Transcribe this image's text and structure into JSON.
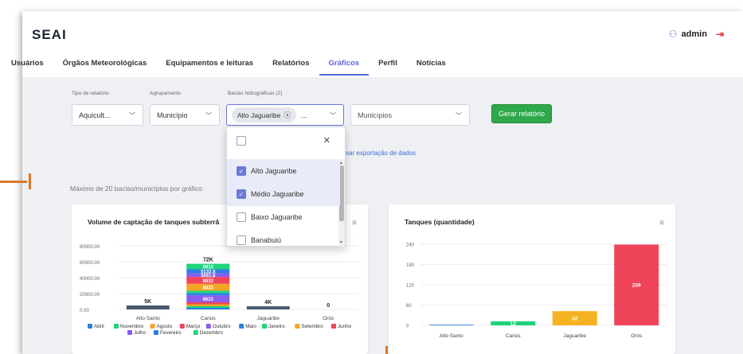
{
  "app": {
    "logo": "SEAI",
    "user": "admin"
  },
  "nav": [
    "Usuários",
    "Órgãos Meteorológicas",
    "Equipamentos e leituras",
    "Relatórios",
    "Gráficos",
    "Perfil",
    "Notícias"
  ],
  "filters": {
    "tipo_label": "Tipo de relatório",
    "tipo_value": "Aquicult...",
    "agrup_label": "Agrupamento",
    "agrup_value": "Município",
    "bacias_label": "Bacias hidrográficas (2)",
    "bacias_chip": "Alto Jaguaribe",
    "bacias_more": "...",
    "municipios_placeholder": "Municípios",
    "generate_button": "Gerar relatório",
    "export_link": "ssar exportação de dados",
    "max_note": "Máximo de 20 bacias/municípios por gráfico"
  },
  "dropdown": {
    "options": [
      {
        "label": "Alto Jaguaribe",
        "checked": true
      },
      {
        "label": "Médio Jaguaribe",
        "checked": true
      },
      {
        "label": "Baixo Jaguaribe",
        "checked": false
      },
      {
        "label": "Banabuiú",
        "checked": false
      }
    ]
  },
  "charts": {
    "left_title": "Volume de captação de tanques subterrâ",
    "right_title": "Tanques (quantidade)"
  },
  "chart_data": [
    {
      "type": "bar",
      "stacked": true,
      "title": "Volume de captação de tanques subterrâ",
      "categories": [
        "Alto Santo",
        "Canús",
        "Jaguaribe",
        "Orós"
      ],
      "yticks": [
        "80000.00",
        "60000.00",
        "40000.00",
        "20000.00",
        "0.00"
      ],
      "ylim": [
        0,
        80000
      ],
      "totals": [
        "5K",
        "72K",
        "4K",
        "0"
      ],
      "legend": [
        "Abril",
        "Novembro",
        "Agosto",
        "Março",
        "Outubro",
        "Maio",
        "Janeiro",
        "Setembro",
        "Junho",
        "Julho",
        "Fevereiro",
        "Dezembro"
      ],
      "colors": {
        "Abril": "#2b7fe0",
        "Novembro": "#1fd37a",
        "Agosto": "#f5a623",
        "Março": "#f0445a",
        "Outubro": "#8a5cf0",
        "Maio": "#2b7fe0",
        "Janeiro": "#1fd37a",
        "Setembro": "#f5a623",
        "Junho": "#f0445a",
        "Julho": "#8a5cf0",
        "Fevereiro": "#2b7fe0",
        "Dezembro": "#1fd37a"
      },
      "stacks": [
        {
          "category": "Alto Santo",
          "segments": [
            {
              "value": 5000,
              "color": "#4a5b6e"
            }
          ]
        },
        {
          "category": "Canús",
          "segments": [
            {
              "value": 2000,
              "color": "#2b7fe0"
            },
            {
              "value": 2000,
              "color": "#1fd37a"
            },
            {
              "value": 2500,
              "color": "#f5a623"
            },
            {
              "value": 2500,
              "color": "#f0445a"
            },
            {
              "value": 8632,
              "color": "#8a5cf0",
              "label": "8632"
            },
            {
              "value": 3000,
              "color": "#2b7fe0"
            },
            {
              "value": 3000,
              "color": "#1fd37a"
            },
            {
              "value": 8632,
              "color": "#f5a623",
              "label": "8832"
            },
            {
              "value": 8632,
              "color": "#f0445a",
              "label": "8832"
            },
            {
              "value": 4500,
              "color": "#8a5cf0",
              "label": "5661.6"
            },
            {
              "value": 5132.8,
              "color": "#2b7fe0",
              "label": "5132.8"
            },
            {
              "value": 6912,
              "color": "#1fd37a",
              "label": "6912"
            }
          ]
        },
        {
          "category": "Jaguaribe",
          "segments": [
            {
              "value": 4000,
              "color": "#4a5b6e"
            }
          ]
        },
        {
          "category": "Orós",
          "segments": []
        }
      ]
    },
    {
      "type": "bar",
      "title": "Tanques (quantidade)",
      "categories": [
        "Alto Santo",
        "Canús",
        "Jaguaribe",
        "Orós"
      ],
      "values": [
        2,
        12,
        42,
        239
      ],
      "labels": [
        "",
        "12",
        "42",
        "239"
      ],
      "colors": [
        "#2b7fe0",
        "#1fd37a",
        "#f5b323",
        "#f0445a"
      ],
      "yticks": [
        "240",
        "180",
        "120",
        "60",
        "0"
      ],
      "ylim": [
        0,
        240
      ]
    }
  ]
}
